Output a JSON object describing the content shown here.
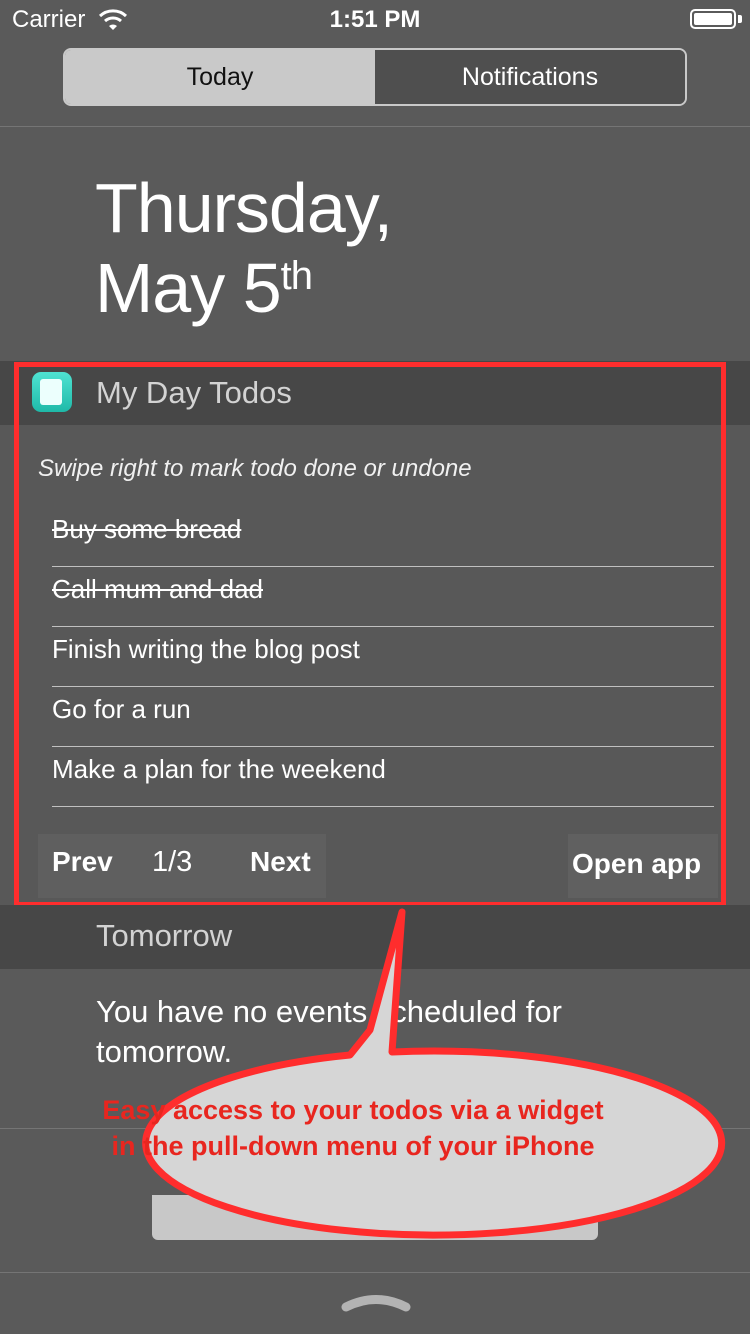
{
  "status_bar": {
    "carrier": "Carrier",
    "time": "1:51 PM"
  },
  "segmented_control": {
    "today_label": "Today",
    "notifications_label": "Notifications"
  },
  "date": {
    "line1": "Thursday,",
    "line2_main": "May 5",
    "line2_suffix": "th"
  },
  "widget": {
    "title": "My Day Todos",
    "hint": "Swipe right to mark todo done or undone",
    "todos": [
      {
        "text": "Buy some bread",
        "done": true
      },
      {
        "text": "Call mum and dad",
        "done": true
      },
      {
        "text": "Finish writing the blog post",
        "done": false
      },
      {
        "text": "Go for a run",
        "done": false
      },
      {
        "text": "Make a plan for the weekend",
        "done": false
      }
    ],
    "prev_label": "Prev",
    "page_indicator": "1/3",
    "next_label": "Next",
    "open_app_label": "Open app"
  },
  "tomorrow": {
    "title": "Tomorrow",
    "message": "You have no events scheduled for tomorrow."
  },
  "callout": {
    "text": "Easy access to your todos via a widget in the pull-down menu of your iPhone"
  },
  "colors": {
    "highlight": "#ff2d2d",
    "callout_text": "#e8261f",
    "app_icon": "#2fc9b8"
  },
  "icons": {
    "wifi": "wifi-icon",
    "battery": "battery-icon",
    "app": "notepad-icon",
    "pull_handle": "chevron-up-icon"
  }
}
